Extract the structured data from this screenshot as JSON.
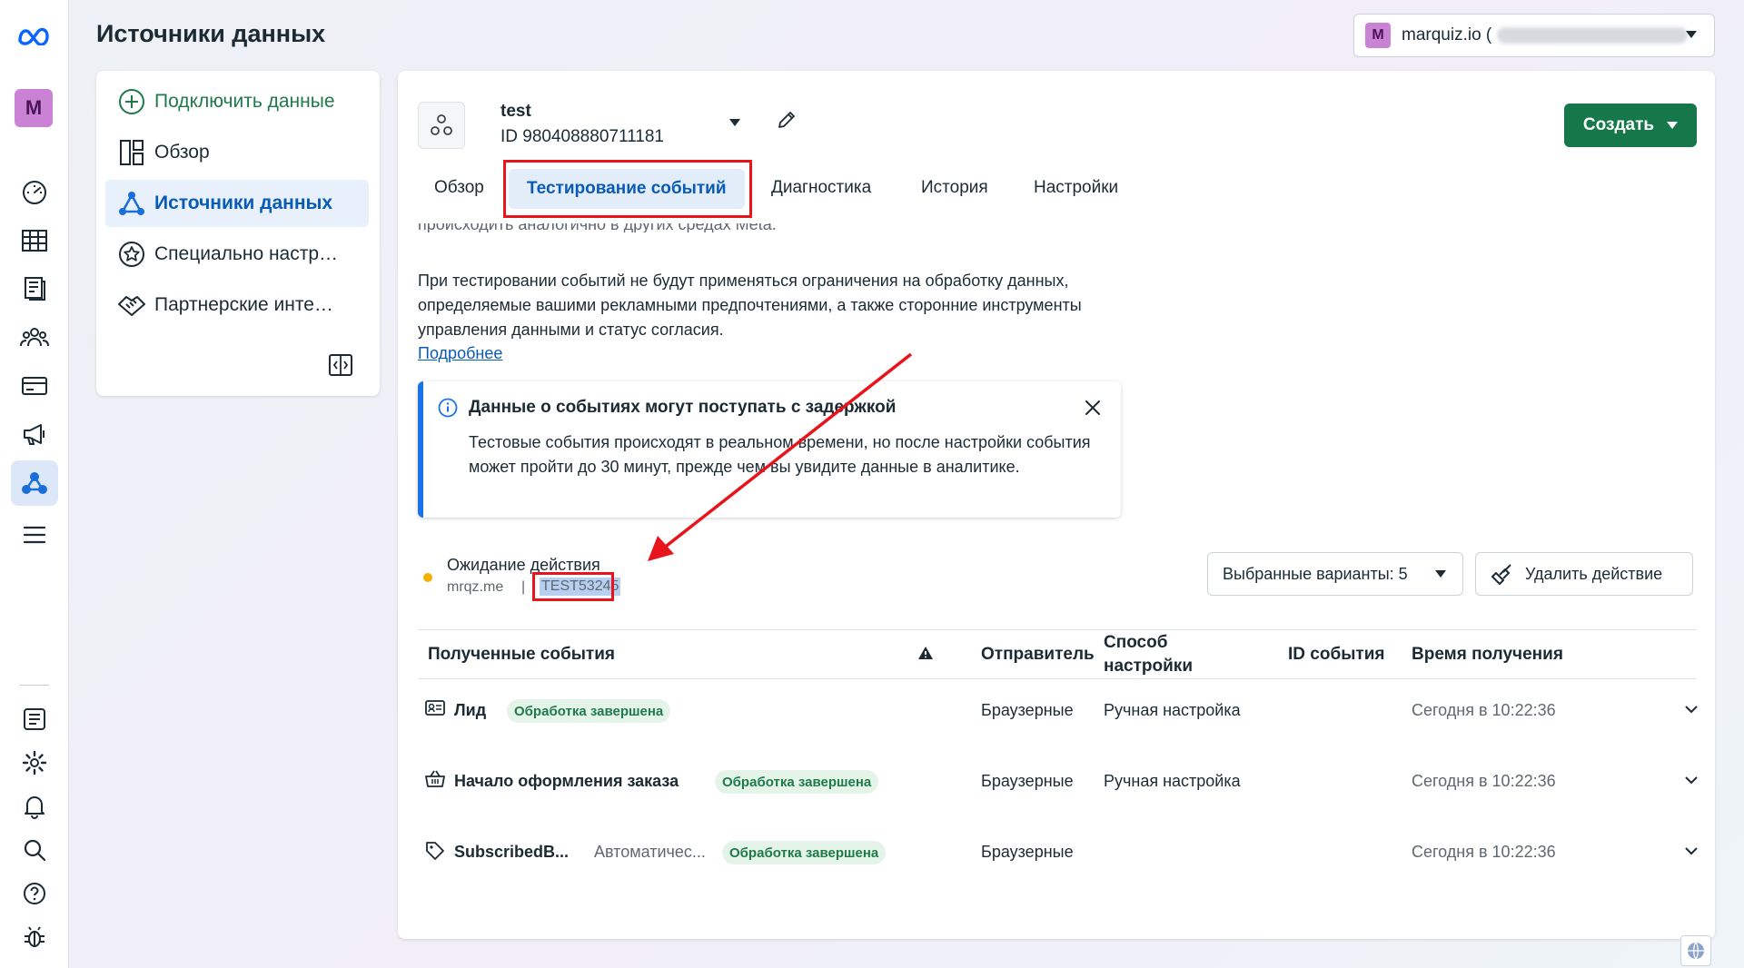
{
  "header": {
    "title": "Источники данных",
    "account": {
      "badge": "M",
      "name": "marquiz.io ("
    }
  },
  "rail": {
    "avatar": "M"
  },
  "nav": {
    "items": [
      {
        "label": "Подключить данные",
        "icon": "plus-circle-icon"
      },
      {
        "label": "Обзор",
        "icon": "overview-icon"
      },
      {
        "label": "Источники данных",
        "icon": "data-sources-icon"
      },
      {
        "label": "Специально настр…",
        "icon": "star-badge-icon"
      },
      {
        "label": "Партнерские инте…",
        "icon": "handshake-icon"
      }
    ]
  },
  "dataset": {
    "name": "test",
    "id": "ID 980408880711181"
  },
  "create_button": "Создать",
  "tabs": [
    "Обзор",
    "Тестирование событий",
    "Диагностика",
    "История",
    "Настройки"
  ],
  "active_tab": "Тестирование событий",
  "cut_text": "происходить аналогично в других средах Meta.",
  "paragraph": "При тестировании событий не будут применяться ограничения на обработку данных, определяемые вашими рекламными предпочтениями, а также сторонние инструменты управления данными и статус согласия.",
  "more_link": "Подробнее",
  "notice": {
    "title": "Данные о событиях могут поступать с задержкой",
    "body": "Тестовые события происходят в реальном времени, но после настройки события может пройти до 30 минут, прежде чем вы увидите данные в аналитике."
  },
  "status": {
    "label": "Ожидание действия",
    "domain": "mrqz.me",
    "separator": "|",
    "test_code": "TEST53245"
  },
  "variants_button": "Выбранные варианты: 5",
  "delete_button": "Удалить действие",
  "table": {
    "headers": {
      "events": "Полученные события",
      "sender": "Отправитель",
      "method": "Способ настройки",
      "event_id": "ID события",
      "time": "Время получения"
    },
    "rows": [
      {
        "icon": "id-card-icon",
        "name": "Лид",
        "extra": "",
        "status": "Обработка завершена",
        "sender": "Браузерные",
        "method": "Ручная настройка",
        "time": "Сегодня в 10:22:36"
      },
      {
        "icon": "basket-icon",
        "name": "Начало оформления заказа",
        "extra": "",
        "status": "Обработка завершена",
        "sender": "Браузерные",
        "method": "Ручная настройка",
        "time": "Сегодня в 10:22:36"
      },
      {
        "icon": "tag-icon",
        "name": "SubscribedB...",
        "extra": "Автоматичес...",
        "status": "Обработка завершена",
        "sender": "Браузерные",
        "method": "",
        "time": "Сегодня в 10:22:36"
      }
    ]
  },
  "colors": {
    "accent_blue": "#0a5bb5",
    "create_green": "#16784a",
    "annotation_red": "#e8141c",
    "pending_dot": "#f5b100"
  }
}
